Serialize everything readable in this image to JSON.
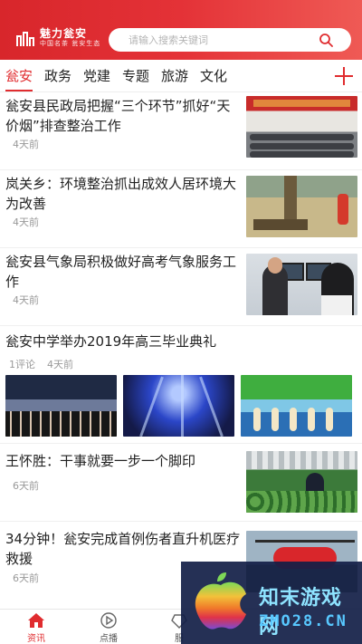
{
  "header": {
    "logo_title": "魅力瓮安",
    "logo_slogan": "中国名茶 瓮安生态",
    "search_placeholder": "请输入搜索关键词"
  },
  "tabs": [
    "瓮安",
    "政务",
    "党建",
    "专题",
    "旅游",
    "文化"
  ],
  "active_tab": "瓮安",
  "news": [
    {
      "title": "瓮安县民政局把握“三个环节”抓好“天价烟”排查整治工作",
      "time": "4天前"
    },
    {
      "title": "岚关乡：环境整治抓出成效人居环境大为改善",
      "time": "4天前"
    },
    {
      "title": "瓮安县气象局积极做好高考气象服务工作",
      "time": "4天前"
    },
    {
      "title": "瓮安中学举办2019年高三毕业典礼",
      "comments": "1评论",
      "time": "4天前"
    },
    {
      "title": "王怀胜：干事就要一步一个脚印",
      "time": "6天前"
    },
    {
      "title": "34分钟！瓮安完成首例伤者直升机医疗救援",
      "time": "6天前"
    }
  ],
  "bottom_nav": [
    {
      "label": "资讯",
      "icon": "home-icon",
      "active": true
    },
    {
      "label": "点播",
      "icon": "play-icon",
      "active": false
    },
    {
      "label": "服",
      "icon": "service-icon",
      "active": false
    }
  ],
  "watermark": {
    "text": "知末游戏网",
    "url": "ZMO28.CN"
  },
  "colors": {
    "brand_red": "#e02c2f",
    "meta_gray": "#999999"
  }
}
